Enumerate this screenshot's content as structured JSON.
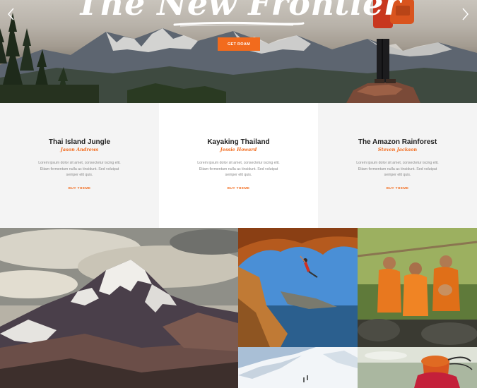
{
  "hero": {
    "title": "The New Frontier",
    "button_label": "GET ROAM"
  },
  "cards": [
    {
      "title": "Thai Island Jungle",
      "author": "Jason Andrews",
      "text": "Lorem ipsum dolor sit amet, consectetur iscing elit. Etiam fermentum nulla ac tincidunt. Sed volutpat semper elit quis.",
      "link": "BUY THEME"
    },
    {
      "title": "Kayaking Thailand",
      "author": "Jessie Howard",
      "text": "Lorem ipsum dolor sit amet, consectetur iscing elit. Etiam fermentum nulla ac tincidunt. Sed volutpat semper elit quis.",
      "link": "BUY THEME"
    },
    {
      "title": "The Amazon Rainforest",
      "author": "Steven Jackson",
      "text": "Lorem ipsum dolor sit amet, consectetur iscing elit. Etiam fermentum nulla ac tincidunt. Sed volutpat semper elit quis.",
      "link": "BUY THEME"
    }
  ],
  "colors": {
    "accent": "#f26b1d",
    "card_bg": "#f4f4f4",
    "heading": "#222222"
  },
  "icons": {
    "prev": "chevron-left-icon",
    "next": "chevron-right-icon"
  },
  "gallery": [
    {
      "name": "gallery-image-mountain"
    },
    {
      "name": "gallery-image-climber"
    },
    {
      "name": "gallery-image-monks"
    },
    {
      "name": "gallery-image-snow-ridge"
    },
    {
      "name": "gallery-image-traveler"
    }
  ]
}
